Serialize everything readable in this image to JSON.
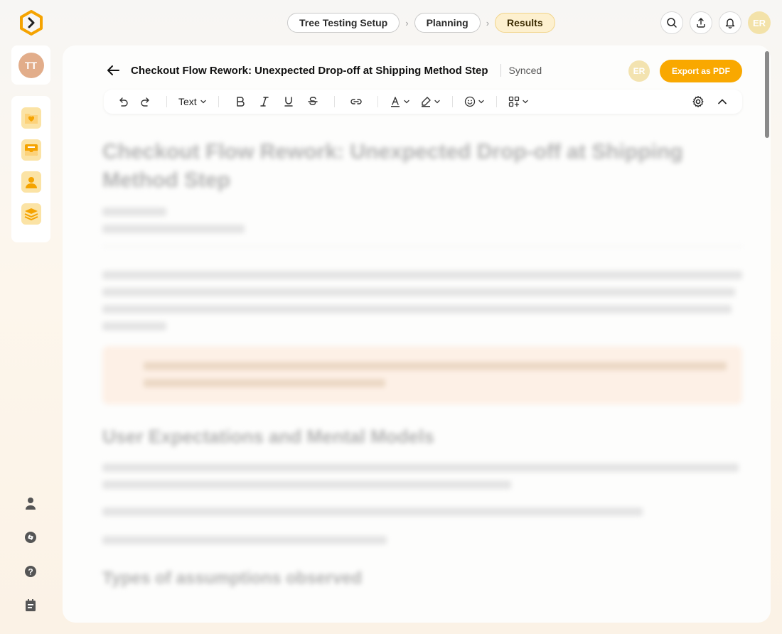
{
  "breadcrumbs": [
    {
      "label": "Tree Testing Setup"
    },
    {
      "label": "Planning"
    },
    {
      "label": "Results"
    }
  ],
  "user": {
    "initials": "ER"
  },
  "sidebar": {
    "profile_initials": "TT",
    "nav": [
      {
        "icon": "folder-heart-icon"
      },
      {
        "icon": "inbox-icon"
      },
      {
        "icon": "user-card-icon"
      },
      {
        "icon": "layers-icon"
      }
    ],
    "bottom": [
      {
        "icon": "person-icon"
      },
      {
        "icon": "link-icon"
      },
      {
        "icon": "help-icon"
      },
      {
        "icon": "notes-icon"
      }
    ]
  },
  "document": {
    "title": "Checkout Flow Rework: Unexpected Drop-off at Shipping Method Step",
    "status": "Synced",
    "collaborator_initials": "ER",
    "export_label": "Export as PDF"
  },
  "toolbar": {
    "text_style": "Text"
  },
  "content_blurred": {
    "heading": "Checkout Flow Rework: Unexpected Drop-off at Shipping Method Step",
    "section_1": "User Expectations and Mental Models",
    "section_2": "Types of assumptions observed"
  },
  "colors": {
    "accent": "#f9a800",
    "active_crumb_bg": "#fdf0cf"
  }
}
